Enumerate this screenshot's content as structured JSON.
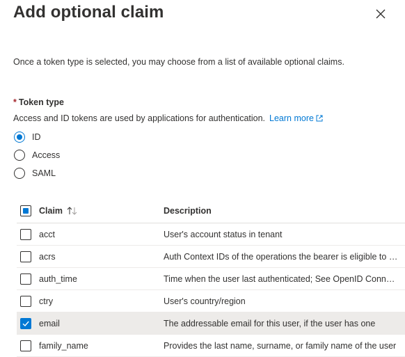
{
  "panel": {
    "title": "Add optional claim",
    "intro": "Once a token type is selected, you may choose from a list of available optional claims."
  },
  "token_type": {
    "required_marker": "*",
    "label": "Token type",
    "help": "Access and ID tokens are used by applications for authentication.",
    "learn_more": "Learn more",
    "options": [
      {
        "label": "ID",
        "selected": true
      },
      {
        "label": "Access",
        "selected": false
      },
      {
        "label": "SAML",
        "selected": false
      }
    ]
  },
  "table": {
    "headers": {
      "claim": "Claim",
      "description": "Description"
    },
    "sort": "ascending",
    "rows": [
      {
        "claim": "acct",
        "description": "User's account status in tenant",
        "checked": false
      },
      {
        "claim": "acrs",
        "description": "Auth Context IDs of the operations the bearer is eligible to perform",
        "checked": false
      },
      {
        "claim": "auth_time",
        "description": "Time when the user last authenticated; See OpenID Connect spec",
        "checked": false
      },
      {
        "claim": "ctry",
        "description": "User's country/region",
        "checked": false
      },
      {
        "claim": "email",
        "description": "The addressable email for this user, if the user has one",
        "checked": true
      },
      {
        "claim": "family_name",
        "description": "Provides the last name, surname, or family name of the user",
        "checked": false
      }
    ]
  },
  "colors": {
    "accent": "#0078d4",
    "required": "#a4262c",
    "selected_row": "#edebe9"
  }
}
